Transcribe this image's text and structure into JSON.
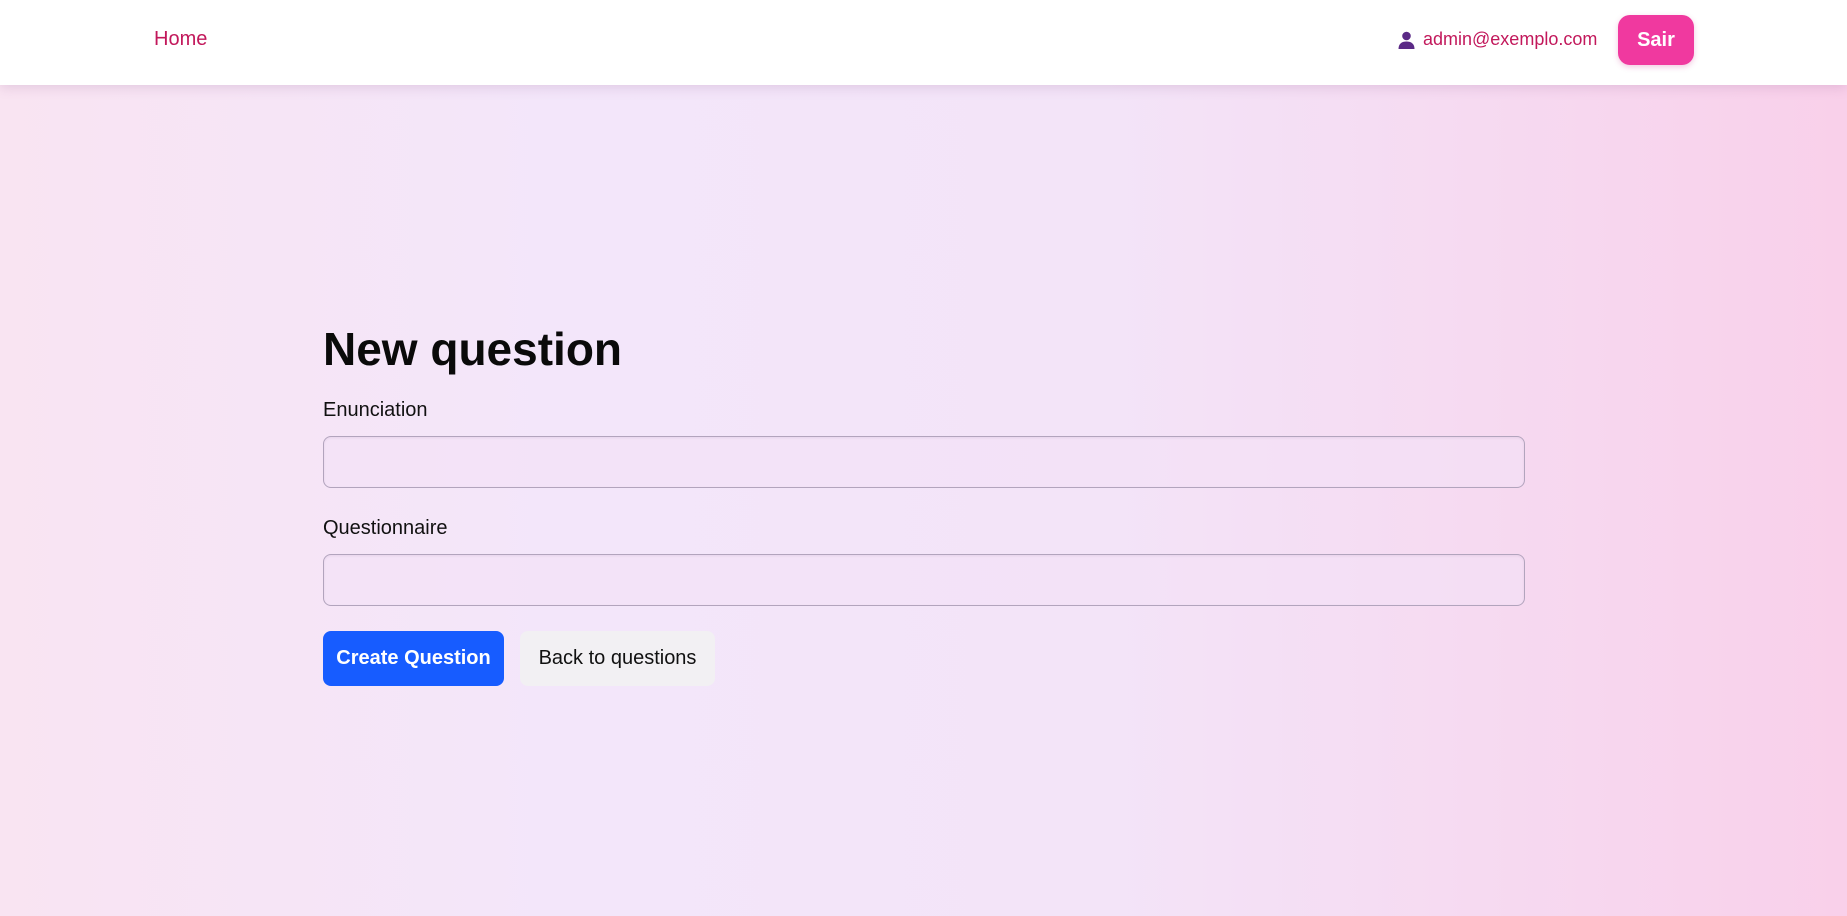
{
  "nav": {
    "home_label": "Home",
    "user_email": "admin@exemplo.com",
    "user_icon": "user-icon",
    "logout_label": "Sair"
  },
  "form": {
    "title": "New question",
    "fields": [
      {
        "label": "Enunciation",
        "value": "",
        "placeholder": ""
      },
      {
        "label": "Questionnaire",
        "value": "",
        "placeholder": ""
      }
    ],
    "submit_label": "Create Question",
    "back_label": "Back to questions"
  },
  "colors": {
    "brand_pink": "#c2185b",
    "logout_bg": "#f0399f",
    "primary_button": "#175cff",
    "secondary_button": "#f2f0f3"
  }
}
